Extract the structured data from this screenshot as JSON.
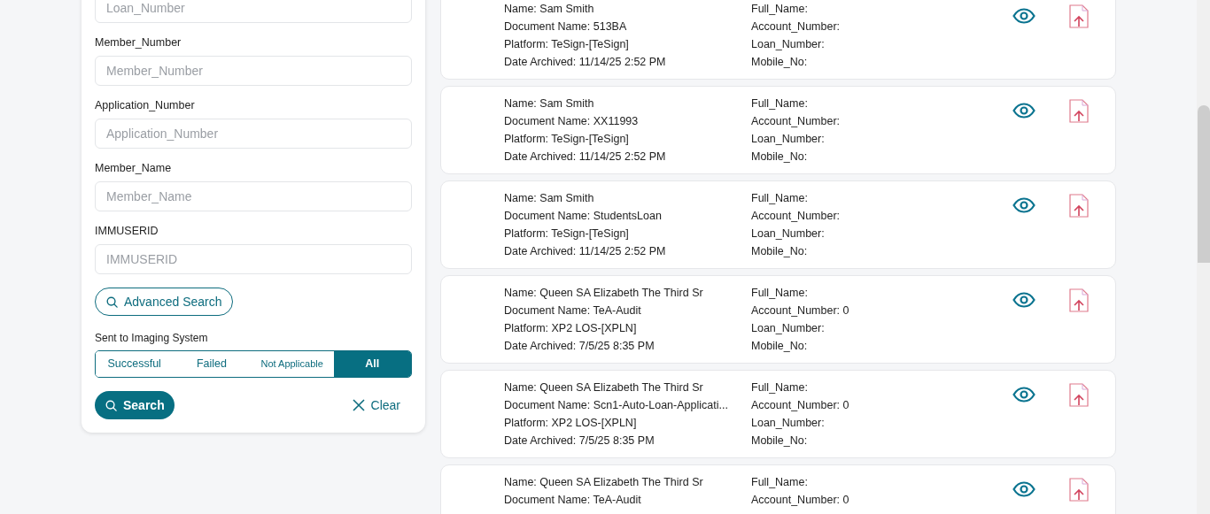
{
  "filters": {
    "fields": [
      {
        "placeholder": "Loan_Number"
      },
      {
        "label": "Member_Number",
        "placeholder": "Member_Number"
      },
      {
        "label": "Application_Number",
        "placeholder": "Application_Number"
      },
      {
        "label": "Member_Name",
        "placeholder": "Member_Name"
      },
      {
        "label": "IMMUSERID",
        "placeholder": "IMMUSERID"
      }
    ],
    "advanced_search": "Advanced Search",
    "imaging_label": "Sent to Imaging System",
    "imaging_options": [
      {
        "label": "Successful",
        "selected": false
      },
      {
        "label": "Failed",
        "selected": false
      },
      {
        "label": "Not Applicable",
        "selected": false
      },
      {
        "label": "All",
        "selected": true
      }
    ],
    "search_button": "Search",
    "clear_button": "Clear"
  },
  "results": [
    {
      "left": [
        "Name: Sam Smith",
        "Document Name: 513BA",
        "Platform: TeSign-[TeSign]",
        "Date Archived: 11/14/25 2:52 PM"
      ],
      "right": [
        "Full_Name:",
        "Account_Number:",
        "Loan_Number:",
        "Mobile_No:"
      ]
    },
    {
      "left": [
        "Name: Sam Smith",
        "Document Name: XX11993",
        "Platform: TeSign-[TeSign]",
        "Date Archived: 11/14/25 2:52 PM"
      ],
      "right": [
        "Full_Name:",
        "Account_Number:",
        "Loan_Number:",
        "Mobile_No:"
      ]
    },
    {
      "left": [
        "Name: Sam Smith",
        "Document Name: StudentsLoan",
        "Platform: TeSign-[TeSign]",
        "Date Archived: 11/14/25 2:52 PM"
      ],
      "right": [
        "Full_Name:",
        "Account_Number:",
        "Loan_Number:",
        "Mobile_No:"
      ]
    },
    {
      "left": [
        "Name: Queen SA Elizabeth The Third Sr",
        "Document Name: TeA-Audit",
        "Platform: XP2 LOS-[XPLN]",
        "Date Archived: 7/5/25 8:35 PM"
      ],
      "right": [
        "Full_Name:",
        "Account_Number: 0",
        "Loan_Number:",
        "Mobile_No:"
      ]
    },
    {
      "left": [
        "Name: Queen SA Elizabeth The Third Sr",
        "Document Name: Scn1-Auto-Loan-Applicati...",
        "Platform: XP2 LOS-[XPLN]",
        "Date Archived: 7/5/25 8:35 PM"
      ],
      "right": [
        "Full_Name:",
        "Account_Number: 0",
        "Loan_Number:",
        "Mobile_No:"
      ]
    },
    {
      "left": [
        "Name: Queen SA Elizabeth The Third Sr",
        "Document Name: TeA-Audit"
      ],
      "right": [
        "Full_Name:",
        "Account_Number: 0"
      ]
    }
  ]
}
